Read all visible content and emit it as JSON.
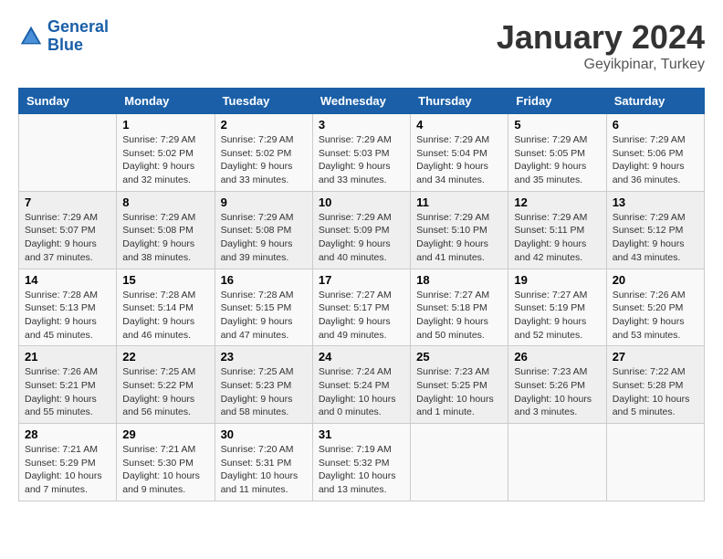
{
  "header": {
    "logo_line1": "General",
    "logo_line2": "Blue",
    "month_year": "January 2024",
    "location": "Geyikpinar, Turkey"
  },
  "columns": [
    "Sunday",
    "Monday",
    "Tuesday",
    "Wednesday",
    "Thursday",
    "Friday",
    "Saturday"
  ],
  "weeks": [
    [
      {
        "day": "",
        "info": ""
      },
      {
        "day": "1",
        "info": "Sunrise: 7:29 AM\nSunset: 5:02 PM\nDaylight: 9 hours\nand 32 minutes."
      },
      {
        "day": "2",
        "info": "Sunrise: 7:29 AM\nSunset: 5:02 PM\nDaylight: 9 hours\nand 33 minutes."
      },
      {
        "day": "3",
        "info": "Sunrise: 7:29 AM\nSunset: 5:03 PM\nDaylight: 9 hours\nand 33 minutes."
      },
      {
        "day": "4",
        "info": "Sunrise: 7:29 AM\nSunset: 5:04 PM\nDaylight: 9 hours\nand 34 minutes."
      },
      {
        "day": "5",
        "info": "Sunrise: 7:29 AM\nSunset: 5:05 PM\nDaylight: 9 hours\nand 35 minutes."
      },
      {
        "day": "6",
        "info": "Sunrise: 7:29 AM\nSunset: 5:06 PM\nDaylight: 9 hours\nand 36 minutes."
      }
    ],
    [
      {
        "day": "7",
        "info": "Sunrise: 7:29 AM\nSunset: 5:07 PM\nDaylight: 9 hours\nand 37 minutes."
      },
      {
        "day": "8",
        "info": "Sunrise: 7:29 AM\nSunset: 5:08 PM\nDaylight: 9 hours\nand 38 minutes."
      },
      {
        "day": "9",
        "info": "Sunrise: 7:29 AM\nSunset: 5:08 PM\nDaylight: 9 hours\nand 39 minutes."
      },
      {
        "day": "10",
        "info": "Sunrise: 7:29 AM\nSunset: 5:09 PM\nDaylight: 9 hours\nand 40 minutes."
      },
      {
        "day": "11",
        "info": "Sunrise: 7:29 AM\nSunset: 5:10 PM\nDaylight: 9 hours\nand 41 minutes."
      },
      {
        "day": "12",
        "info": "Sunrise: 7:29 AM\nSunset: 5:11 PM\nDaylight: 9 hours\nand 42 minutes."
      },
      {
        "day": "13",
        "info": "Sunrise: 7:29 AM\nSunset: 5:12 PM\nDaylight: 9 hours\nand 43 minutes."
      }
    ],
    [
      {
        "day": "14",
        "info": "Sunrise: 7:28 AM\nSunset: 5:13 PM\nDaylight: 9 hours\nand 45 minutes."
      },
      {
        "day": "15",
        "info": "Sunrise: 7:28 AM\nSunset: 5:14 PM\nDaylight: 9 hours\nand 46 minutes."
      },
      {
        "day": "16",
        "info": "Sunrise: 7:28 AM\nSunset: 5:15 PM\nDaylight: 9 hours\nand 47 minutes."
      },
      {
        "day": "17",
        "info": "Sunrise: 7:27 AM\nSunset: 5:17 PM\nDaylight: 9 hours\nand 49 minutes."
      },
      {
        "day": "18",
        "info": "Sunrise: 7:27 AM\nSunset: 5:18 PM\nDaylight: 9 hours\nand 50 minutes."
      },
      {
        "day": "19",
        "info": "Sunrise: 7:27 AM\nSunset: 5:19 PM\nDaylight: 9 hours\nand 52 minutes."
      },
      {
        "day": "20",
        "info": "Sunrise: 7:26 AM\nSunset: 5:20 PM\nDaylight: 9 hours\nand 53 minutes."
      }
    ],
    [
      {
        "day": "21",
        "info": "Sunrise: 7:26 AM\nSunset: 5:21 PM\nDaylight: 9 hours\nand 55 minutes."
      },
      {
        "day": "22",
        "info": "Sunrise: 7:25 AM\nSunset: 5:22 PM\nDaylight: 9 hours\nand 56 minutes."
      },
      {
        "day": "23",
        "info": "Sunrise: 7:25 AM\nSunset: 5:23 PM\nDaylight: 9 hours\nand 58 minutes."
      },
      {
        "day": "24",
        "info": "Sunrise: 7:24 AM\nSunset: 5:24 PM\nDaylight: 10 hours\nand 0 minutes."
      },
      {
        "day": "25",
        "info": "Sunrise: 7:23 AM\nSunset: 5:25 PM\nDaylight: 10 hours\nand 1 minute."
      },
      {
        "day": "26",
        "info": "Sunrise: 7:23 AM\nSunset: 5:26 PM\nDaylight: 10 hours\nand 3 minutes."
      },
      {
        "day": "27",
        "info": "Sunrise: 7:22 AM\nSunset: 5:28 PM\nDaylight: 10 hours\nand 5 minutes."
      }
    ],
    [
      {
        "day": "28",
        "info": "Sunrise: 7:21 AM\nSunset: 5:29 PM\nDaylight: 10 hours\nand 7 minutes."
      },
      {
        "day": "29",
        "info": "Sunrise: 7:21 AM\nSunset: 5:30 PM\nDaylight: 10 hours\nand 9 minutes."
      },
      {
        "day": "30",
        "info": "Sunrise: 7:20 AM\nSunset: 5:31 PM\nDaylight: 10 hours\nand 11 minutes."
      },
      {
        "day": "31",
        "info": "Sunrise: 7:19 AM\nSunset: 5:32 PM\nDaylight: 10 hours\nand 13 minutes."
      },
      {
        "day": "",
        "info": ""
      },
      {
        "day": "",
        "info": ""
      },
      {
        "day": "",
        "info": ""
      }
    ]
  ]
}
